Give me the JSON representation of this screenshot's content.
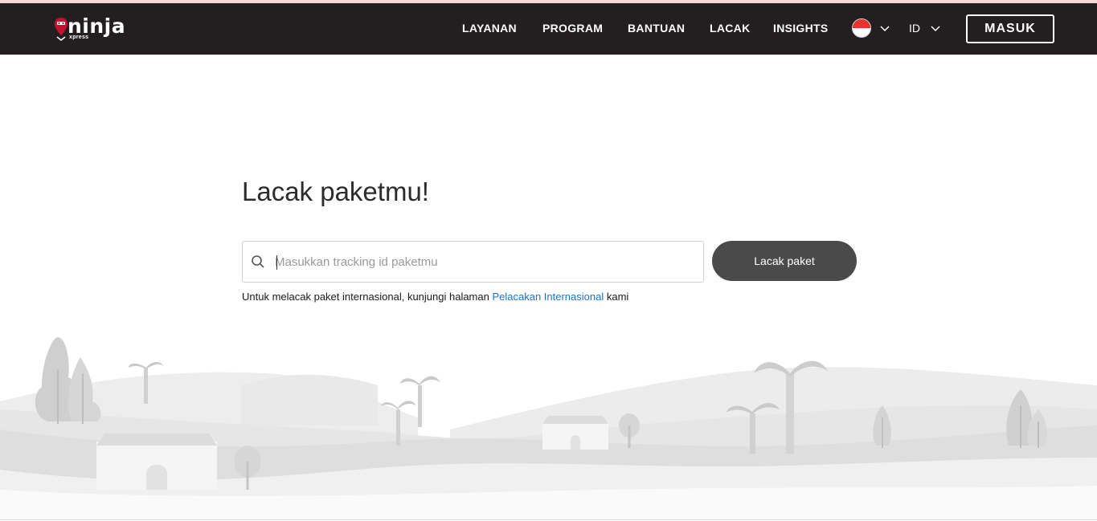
{
  "brand": {
    "name": "ninja",
    "sub": "xpress"
  },
  "nav": {
    "items": [
      {
        "label": "LAYANAN"
      },
      {
        "label": "PROGRAM"
      },
      {
        "label": "BANTUAN"
      },
      {
        "label": "LACAK"
      },
      {
        "label": "INSIGHTS"
      }
    ],
    "country_icon": "indonesia-flag-icon",
    "language": "ID",
    "login_label": "MASUK"
  },
  "main": {
    "title": "Lacak paketmu!",
    "search": {
      "placeholder": "Masukkan tracking id paketmu",
      "value": ""
    },
    "track_button": "Lacak paket",
    "note_prefix": "Untuk melacak paket internasional, kunjungi halaman ",
    "note_link": "Pelacakan Internasional",
    "note_suffix": " kami"
  },
  "colors": {
    "header_bg": "#231f20",
    "button_bg": "#4a4a4a",
    "link": "#1a73c9",
    "brand_red": "#c8102e"
  }
}
